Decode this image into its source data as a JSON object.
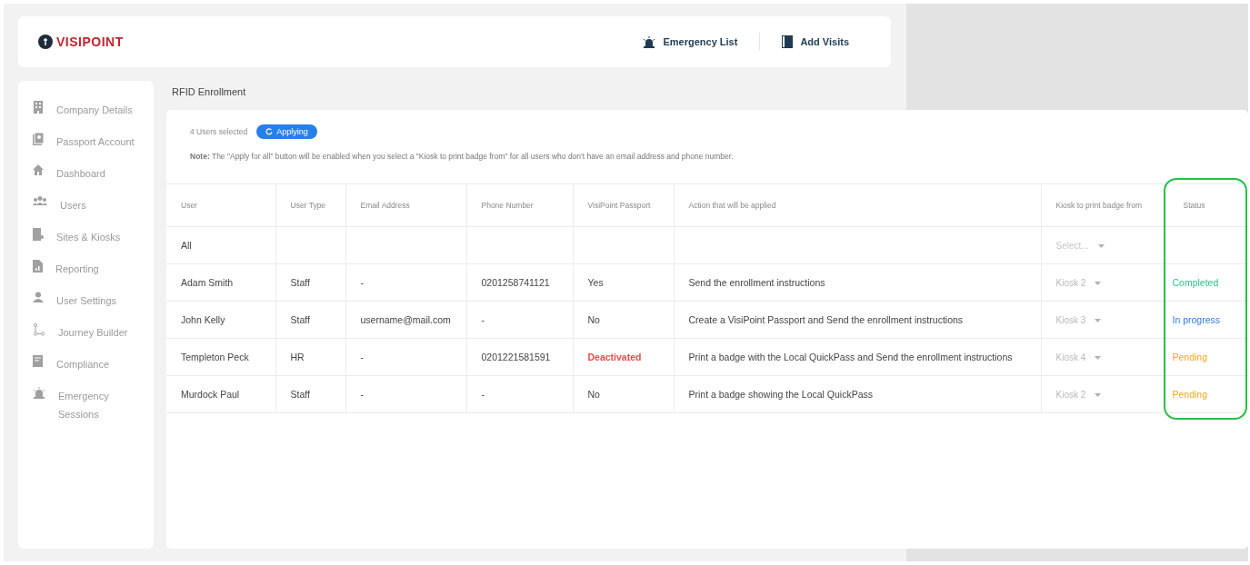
{
  "header": {
    "logo": "VISIPOINT",
    "actions": [
      {
        "label": "Emergency List"
      },
      {
        "label": "Add Visits"
      }
    ]
  },
  "sidebar": {
    "items": [
      {
        "label": "Company Details"
      },
      {
        "label": "Passport Account"
      },
      {
        "label": "Dashboard"
      },
      {
        "label": "Users"
      },
      {
        "label": "Sites & Kiosks"
      },
      {
        "label": "Reporting"
      },
      {
        "label": "User Settings"
      },
      {
        "label": "Journey Builder"
      },
      {
        "label": "Compliance"
      },
      {
        "label": "Emergency Sessions"
      }
    ]
  },
  "page_title": "RFID Enrollment",
  "selection": {
    "count": "4 Users selected",
    "button": "Applying"
  },
  "note": "**Note:** The \"Apply for all\" button will be enabled when you select a \"Kiosk to print badge from\" for all users who don't have an email address and phone number.",
  "table": {
    "columns": [
      "User",
      "User Type",
      "Email Address",
      "Phone Number",
      "VisiPoint Passport",
      "Action that will be applied",
      "Kiosk to print badge from",
      "Status"
    ],
    "all_row": {
      "user": "All",
      "kiosk": {
        "placeholder": "Select..."
      }
    },
    "rows": [
      {
        "user": "Adam Smith",
        "type": "Staff",
        "email": "-",
        "phone": "0201258741121",
        "passport": {
          "text": "Yes",
          "kind": "normal"
        },
        "action": "Send the enrollment instructions",
        "kiosk": {
          "value": "Kiosk 2"
        },
        "status": {
          "text": "Completed",
          "kind": "completed"
        }
      },
      {
        "user": "John Kelly",
        "type": "Staff",
        "email": "username@mail.com",
        "phone": "-",
        "passport": {
          "text": "No",
          "kind": "normal"
        },
        "action": "Create a VisiPoint Passport and Send the enrollment instructions",
        "kiosk": {
          "value": "Kiosk 3"
        },
        "status": {
          "text": "In progress",
          "kind": "in_progress"
        }
      },
      {
        "user": "Templeton Peck",
        "type": "HR",
        "email": "-",
        "phone": "0201221581591",
        "passport": {
          "text": "Deactivated",
          "kind": "deactivated"
        },
        "action": "Print a badge with the Local QuickPass and Send the enrollment instructions",
        "kiosk": {
          "value": "Kiosk 4"
        },
        "status": {
          "text": "Pending",
          "kind": "pending"
        }
      },
      {
        "user": "Murdock Paul",
        "type": "Staff",
        "email": "-",
        "phone": "-",
        "passport": {
          "text": "No",
          "kind": "normal"
        },
        "action": "Print a badge showing the Local QuickPass",
        "kiosk": {
          "value": "Kiosk 2"
        },
        "status": {
          "text": "Pending",
          "kind": "pending"
        }
      }
    ]
  }
}
